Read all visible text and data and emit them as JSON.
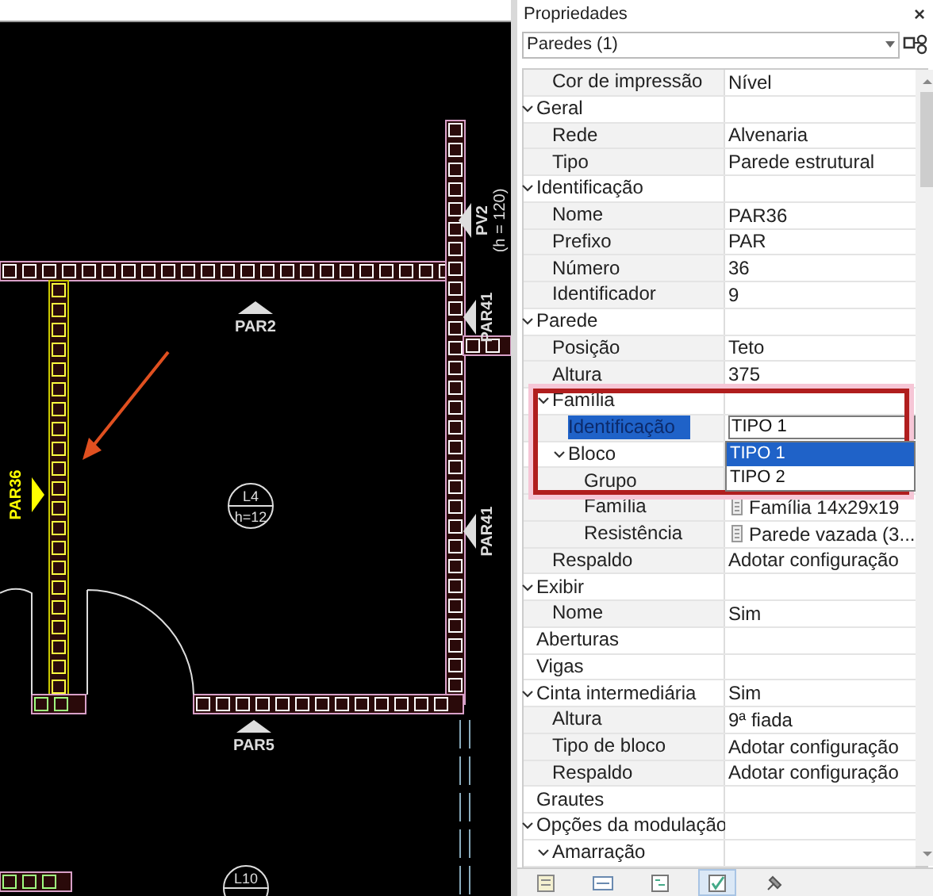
{
  "drawing": {
    "wall_tags": [
      {
        "text": "PAR2",
        "selected": false
      },
      {
        "text": "PV2",
        "note": "(h = 120)",
        "selected": false
      },
      {
        "text": "PAR41",
        "selected": false
      },
      {
        "text": "PAR36",
        "selected": true
      },
      {
        "text": "PAR41",
        "selected": false
      },
      {
        "text": "PAR5",
        "selected": false
      }
    ],
    "slab_tags": [
      {
        "name": "L4",
        "height": "h=12"
      },
      {
        "name": "L10"
      }
    ]
  },
  "panel": {
    "title": "Propriedades",
    "close": "×",
    "selector": {
      "value": "Paredes (1)"
    },
    "rows": [
      {
        "kind": "property",
        "label": "Cor de impressão",
        "value": "Nível",
        "selected": false
      },
      {
        "kind": "category",
        "label": "Geral",
        "expanded": true,
        "selected": false,
        "children": [
          {
            "kind": "property",
            "label": "Rede",
            "value": "Alvenaria",
            "selected": false
          },
          {
            "kind": "property",
            "label": "Tipo",
            "value": "Parede estrutural",
            "selected": false
          }
        ]
      },
      {
        "kind": "category",
        "label": "Identificação",
        "expanded": true,
        "selected": false,
        "children": [
          {
            "kind": "property",
            "label": "Nome",
            "value": "PAR36",
            "selected": false
          },
          {
            "kind": "property",
            "label": "Prefixo",
            "value": "PAR",
            "selected": false
          },
          {
            "kind": "property",
            "label": "Número",
            "value": "36",
            "selected": false
          },
          {
            "kind": "property",
            "label": "Identificador",
            "value": "9",
            "selected": false
          }
        ]
      },
      {
        "kind": "category",
        "label": "Parede",
        "expanded": true,
        "selected": false,
        "children": [
          {
            "kind": "property",
            "label": "Posição",
            "value": "Teto",
            "selected": false
          },
          {
            "kind": "property",
            "label": "Altura",
            "value": "375",
            "selected": false
          },
          {
            "kind": "category",
            "label": "Família",
            "expanded": true,
            "selected": false,
            "children": [
              {
                "kind": "property",
                "label": "Identificação",
                "value": "TIPO 1",
                "selected": true,
                "options": [
                  {
                    "label": "TIPO 1",
                    "selected": true
                  },
                  {
                    "label": "TIPO 2",
                    "selected": false
                  }
                ]
              },
              {
                "kind": "category",
                "label": "Bloco",
                "expanded": true,
                "selected": false,
                "children": [
                  {
                    "kind": "property",
                    "label": "Grupo",
                    "selected": false
                  },
                  {
                    "kind": "block_property",
                    "label": "Família",
                    "value": "Família 14x29x19",
                    "selected": false
                  },
                  {
                    "kind": "block_property",
                    "label": "Resistência",
                    "value": "Parede vazada (3...",
                    "selected": false
                  }
                ]
              }
            ]
          },
          {
            "kind": "property",
            "label": "Respaldo",
            "value": "Adotar configuração",
            "selected": false
          }
        ]
      },
      {
        "kind": "category",
        "label": "Exibir",
        "expanded": true,
        "selected": false,
        "children": [
          {
            "kind": "property",
            "label": "Nome",
            "value": "Sim",
            "selected": false
          }
        ]
      },
      {
        "kind": "category",
        "label": "Aberturas",
        "selected": false
      },
      {
        "kind": "category",
        "label": "Vigas",
        "selected": false
      },
      {
        "kind": "category",
        "label": "Cinta intermediária",
        "value": "Sim",
        "expanded": true,
        "selected": false,
        "children": [
          {
            "kind": "property",
            "label": "Altura",
            "value": "9ª fiada",
            "selected": false
          },
          {
            "kind": "property",
            "label": "Tipo de bloco",
            "value": "Adotar configuração",
            "selected": false
          },
          {
            "kind": "property",
            "label": "Respaldo",
            "value": "Adotar configuração",
            "selected": false
          }
        ]
      },
      {
        "kind": "category",
        "label": "Grautes",
        "selected": false
      },
      {
        "kind": "category",
        "label": "Opções da modulação",
        "expanded": true,
        "selected": false,
        "children": [
          {
            "kind": "category",
            "label": "Amarração",
            "expanded": true,
            "selected": false
          }
        ]
      }
    ],
    "toolbar": [
      {
        "selected": false
      },
      {
        "selected": false
      },
      {
        "selected": false
      },
      {
        "selected": true
      },
      {
        "selected": false
      }
    ]
  }
}
